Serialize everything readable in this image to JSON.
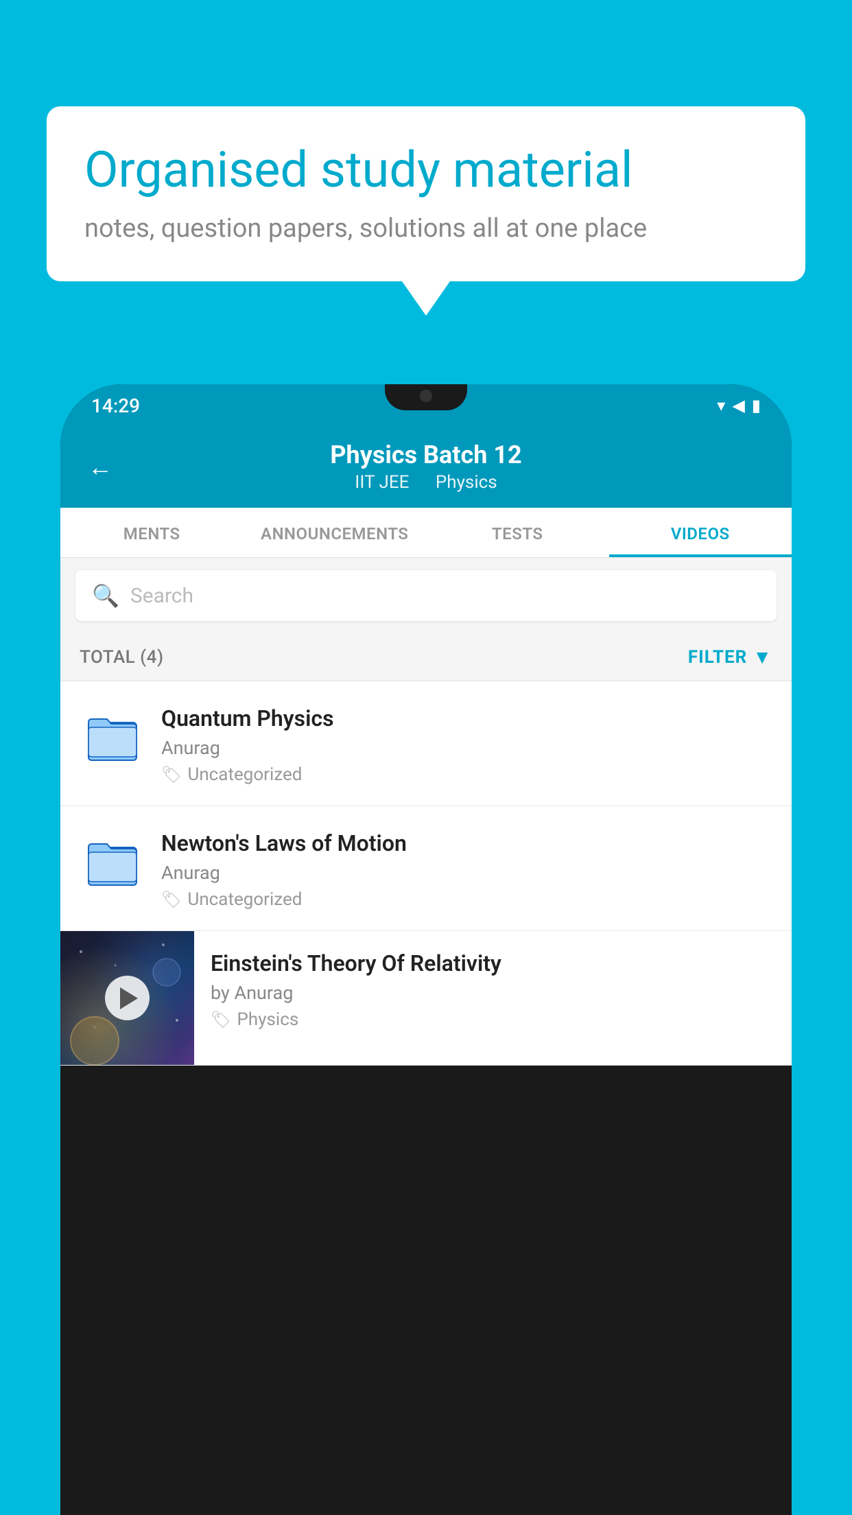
{
  "background_color": "#00BBDD",
  "speech_bubble": {
    "headline": "Organised study material",
    "subtext": "notes, question papers, solutions all at one place"
  },
  "phone": {
    "status_bar": {
      "time": "14:29",
      "icons": "▾◀▮"
    },
    "header": {
      "back_label": "←",
      "title": "Physics Batch 12",
      "subtitle_1": "IIT JEE",
      "subtitle_2": "Physics"
    },
    "tabs": [
      {
        "label": "MENTS",
        "active": false
      },
      {
        "label": "ANNOUNCEMENTS",
        "active": false
      },
      {
        "label": "TESTS",
        "active": false
      },
      {
        "label": "VIDEOS",
        "active": true
      }
    ],
    "search": {
      "placeholder": "Search"
    },
    "filter_bar": {
      "total_label": "TOTAL (4)",
      "filter_label": "FILTER"
    },
    "videos": [
      {
        "id": "quantum-physics",
        "title": "Quantum Physics",
        "author": "Anurag",
        "tag": "Uncategorized",
        "has_thumbnail": false
      },
      {
        "id": "newtons-laws",
        "title": "Newton's Laws of Motion",
        "author": "Anurag",
        "tag": "Uncategorized",
        "has_thumbnail": false
      },
      {
        "id": "einstein-relativity",
        "title": "Einstein's Theory Of Relativity",
        "author": "by Anurag",
        "tag": "Physics",
        "has_thumbnail": true
      }
    ]
  }
}
